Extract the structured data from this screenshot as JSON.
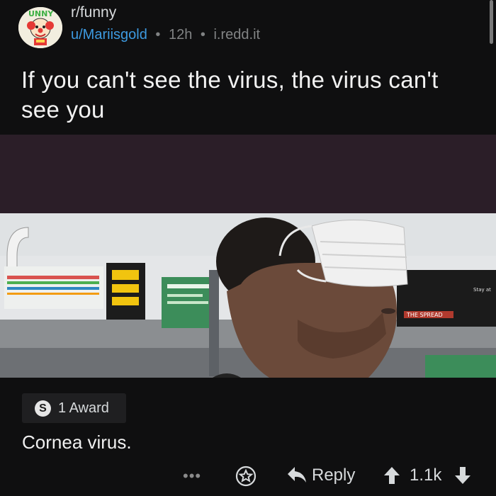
{
  "post": {
    "subreddit": "r/funny",
    "author": "u/Mariisgold",
    "age": "12h",
    "domain": "i.redd.it",
    "separator": "•",
    "title": "If you can't see the virus, the virus can't see you"
  },
  "image": {
    "sign_text": "THE SPREAD",
    "sign_text_right": "Stay at"
  },
  "comment": {
    "award_label": "1 Award",
    "award_glyph": "S",
    "body": "Cornea virus."
  },
  "actions": {
    "more_label": "•••",
    "reply_label": "Reply",
    "score": "1.1k"
  },
  "colors": {
    "background": "#0f0f10",
    "username": "#3d9ae0",
    "media_band": "#2b1e28"
  }
}
